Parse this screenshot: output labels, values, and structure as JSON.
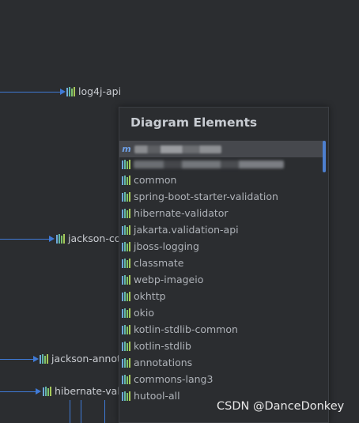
{
  "graph_nodes": [
    {
      "label": "log4j-api"
    },
    {
      "label": "jackson-co"
    },
    {
      "label": "jackson-annot"
    },
    {
      "label": "hibernate-vali"
    }
  ],
  "popup": {
    "title": "Diagram Elements",
    "items": [
      {
        "label": "common"
      },
      {
        "label": "spring-boot-starter-validation"
      },
      {
        "label": "hibernate-validator"
      },
      {
        "label": "jakarta.validation-api"
      },
      {
        "label": "jboss-logging"
      },
      {
        "label": "classmate"
      },
      {
        "label": "webp-imageio"
      },
      {
        "label": "okhttp"
      },
      {
        "label": "okio"
      },
      {
        "label": "kotlin-stdlib-common"
      },
      {
        "label": "kotlin-stdlib"
      },
      {
        "label": "annotations"
      },
      {
        "label": "commons-lang3"
      },
      {
        "label": "hutool-all"
      }
    ]
  },
  "watermark": "CSDN @DanceDonkey",
  "colors": {
    "edge": "#3f7ad6",
    "background": "#2b2d30",
    "popup_border": "#3c3f44"
  },
  "icons": {
    "library": "library-bars-icon",
    "module": "maven-module-icon"
  }
}
